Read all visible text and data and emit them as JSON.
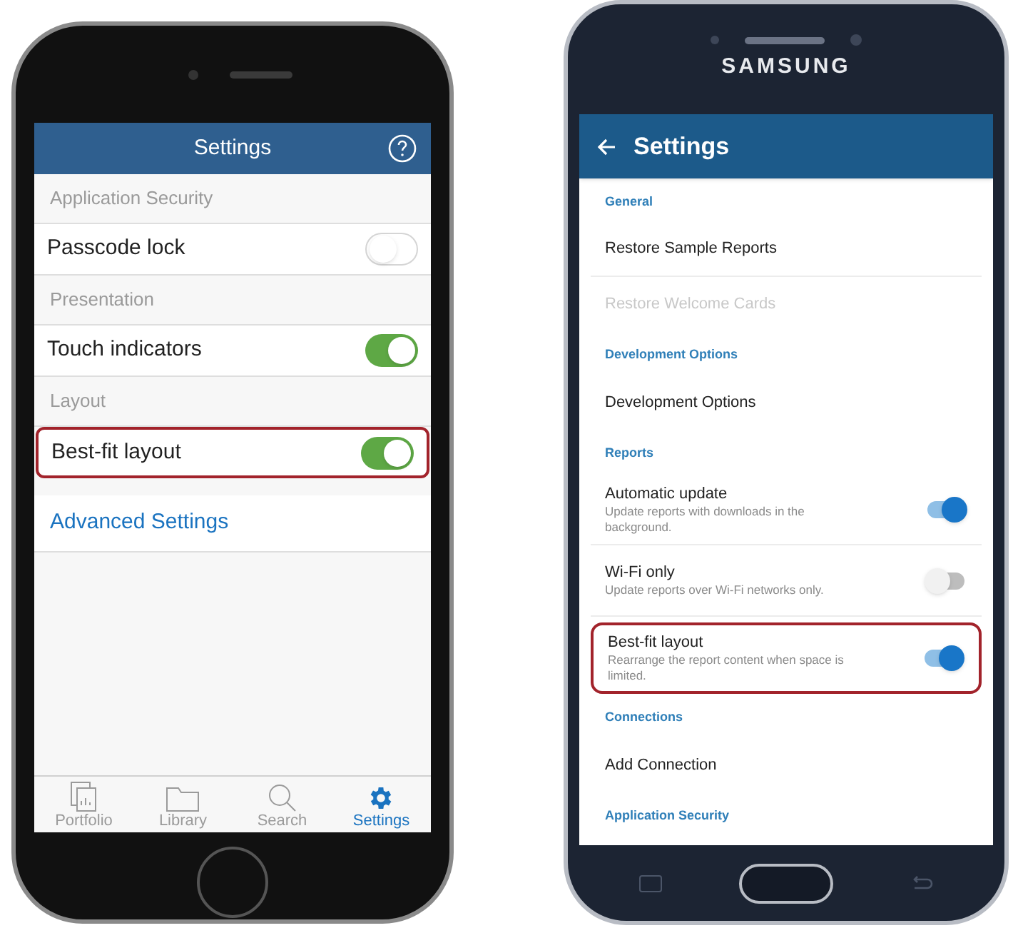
{
  "ios_phone": {
    "title": "Settings",
    "sections": [
      {
        "header": "Application Security",
        "rows": [
          {
            "label": "Passcode lock",
            "on": false,
            "highlighted": false
          }
        ]
      },
      {
        "header": "Presentation",
        "rows": [
          {
            "label": "Touch indicators",
            "on": true,
            "highlighted": false
          }
        ]
      },
      {
        "header": "Layout",
        "rows": [
          {
            "label": "Best-fit layout",
            "on": true,
            "highlighted": true
          }
        ]
      }
    ],
    "link": "Advanced Settings",
    "tabs": [
      {
        "label": "Portfolio",
        "kind": "portfolio",
        "selected": false
      },
      {
        "label": "Library",
        "kind": "library",
        "selected": false
      },
      {
        "label": "Search",
        "kind": "search",
        "selected": false
      },
      {
        "label": "Settings",
        "kind": "settings",
        "selected": true
      }
    ]
  },
  "android_phone": {
    "brand": "SAMSUNG",
    "title": "Settings",
    "items": [
      {
        "kind": "section",
        "label": "General"
      },
      {
        "kind": "action",
        "label": "Restore Sample Reports",
        "disabled": false
      },
      {
        "kind": "action",
        "label": "Restore Welcome Cards",
        "disabled": true
      },
      {
        "kind": "section",
        "label": "Development Options"
      },
      {
        "kind": "action",
        "label": "Development Options",
        "disabled": false
      },
      {
        "kind": "section",
        "label": "Reports"
      },
      {
        "kind": "toggle",
        "label": "Automatic update",
        "description": "Update reports with downloads in the background.",
        "on": true,
        "highlighted": false
      },
      {
        "kind": "toggle",
        "label": "Wi-Fi only",
        "description": "Update reports over Wi-Fi networks only.",
        "on": false,
        "highlighted": false
      },
      {
        "kind": "toggle",
        "label": "Best-fit layout",
        "description": "Rearrange the report content when space is limited.",
        "on": true,
        "highlighted": true
      },
      {
        "kind": "section",
        "label": "Connections"
      },
      {
        "kind": "action",
        "label": "Add Connection",
        "disabled": false
      },
      {
        "kind": "section",
        "label": "Application Security"
      }
    ]
  }
}
